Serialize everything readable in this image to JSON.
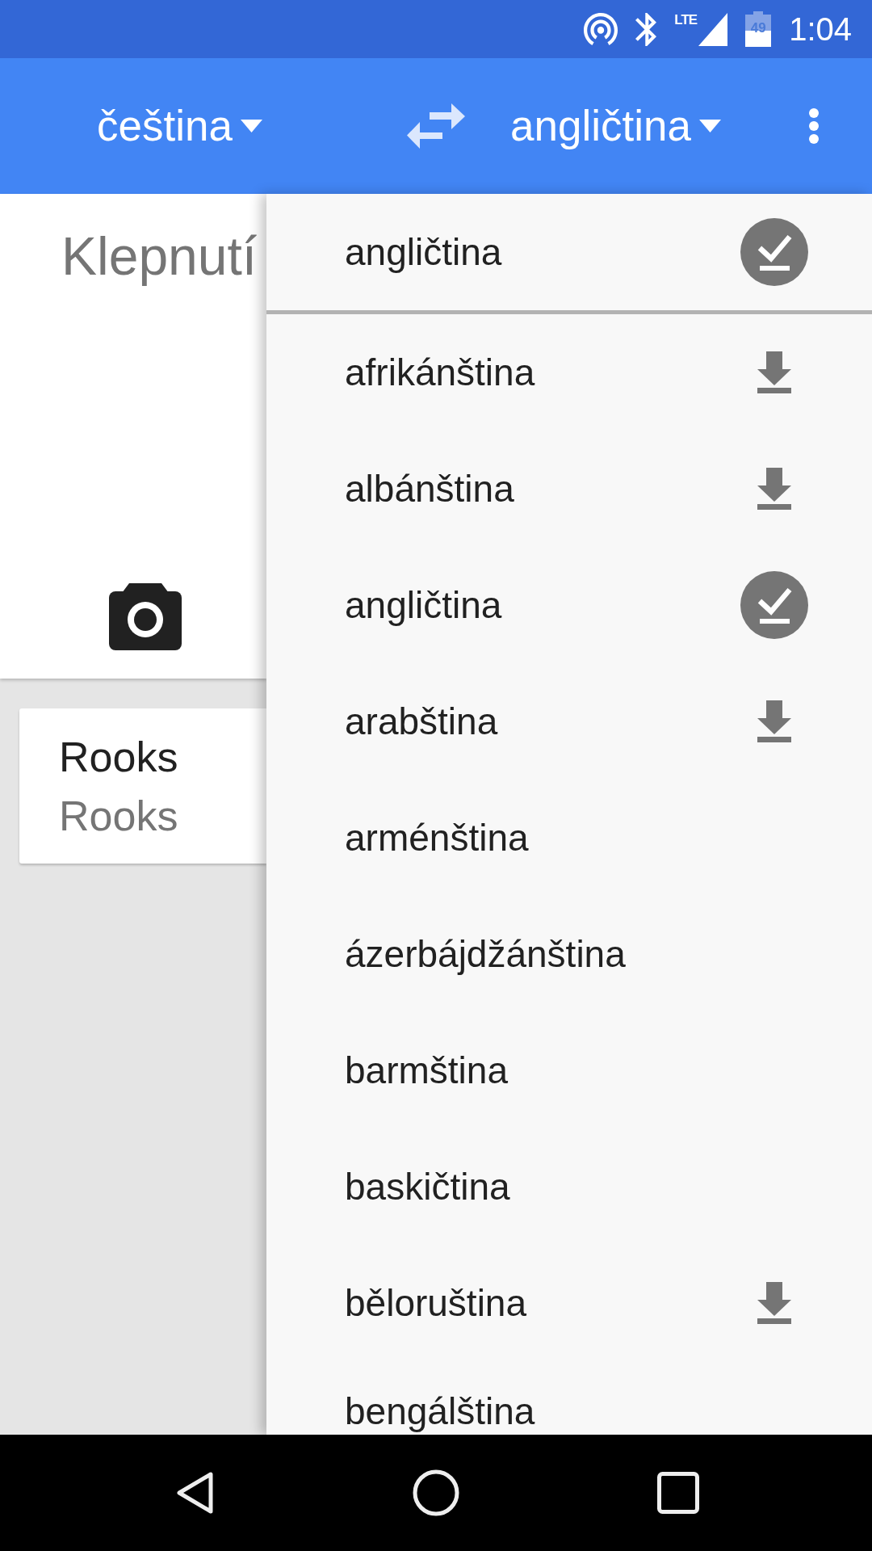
{
  "status_bar": {
    "network_type": "LTE",
    "battery_text": "49",
    "time": "1:04"
  },
  "app_bar": {
    "source_language": "čeština",
    "target_language": "angličtina"
  },
  "input": {
    "placeholder": "Klepnutí"
  },
  "history": [
    {
      "source": "Rooks",
      "translation": "Rooks"
    }
  ],
  "language_menu": {
    "current": {
      "label": "angličtina",
      "kind": "downloaded"
    },
    "options": [
      {
        "label": "afrikánština",
        "kind": "downloadable"
      },
      {
        "label": "albánština",
        "kind": "downloadable"
      },
      {
        "label": "angličtina",
        "kind": "downloaded"
      },
      {
        "label": "arabština",
        "kind": "downloadable"
      },
      {
        "label": "arménština",
        "kind": "online"
      },
      {
        "label": "ázerbájdžánština",
        "kind": "online"
      },
      {
        "label": "barmština",
        "kind": "online"
      },
      {
        "label": "baskičtina",
        "kind": "online"
      },
      {
        "label": "běloruština",
        "kind": "downloadable"
      },
      {
        "label": "bengálština",
        "kind": "online"
      }
    ]
  }
}
